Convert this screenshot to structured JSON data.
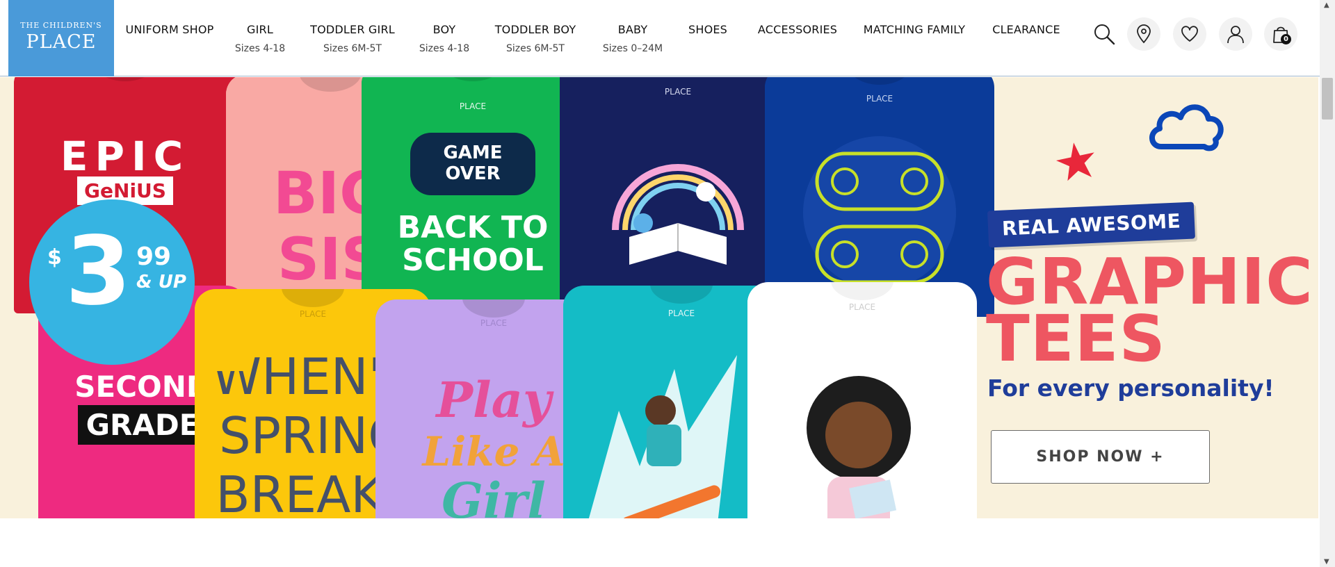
{
  "logo": {
    "line1": "THE CHILDREN'S",
    "line2": "PLACE"
  },
  "nav": [
    {
      "label": "UNIFORM SHOP",
      "sub": ""
    },
    {
      "label": "GIRL",
      "sub": "Sizes 4-18"
    },
    {
      "label": "TODDLER GIRL",
      "sub": "Sizes 6M-5T"
    },
    {
      "label": "BOY",
      "sub": "Sizes 4-18"
    },
    {
      "label": "TODDLER BOY",
      "sub": "Sizes 6M-5T"
    },
    {
      "label": "BABY",
      "sub": "Sizes 0–24M"
    },
    {
      "label": "SHOES",
      "sub": ""
    },
    {
      "label": "ACCESSORIES",
      "sub": ""
    },
    {
      "label": "MATCHING FAMILY",
      "sub": ""
    },
    {
      "label": "CLEARANCE",
      "sub": ""
    }
  ],
  "header_icons": [
    "search-icon",
    "location-pin-icon",
    "heart-icon",
    "account-icon",
    "shopping-bag-icon"
  ],
  "cart": {
    "count": "0"
  },
  "hero": {
    "price": {
      "currency": "$",
      "dollars": "3",
      "cents": "99",
      "suffix": "& UP"
    },
    "tag": "REAL AWESOME",
    "title_line1": "GRAPHIC",
    "title_line2": "TEES",
    "subtitle": "For every personality!",
    "cta": "SHOP NOW  +",
    "tees": {
      "red": {
        "line1": "EPIC",
        "line2": "GeNiUS"
      },
      "pink": {
        "line1": "BIG",
        "line2": "SIS"
      },
      "green": {
        "line1": "GAME",
        "line2": "OVER",
        "line3": "BACK TO",
        "line4": "SCHOOL"
      },
      "magenta": {
        "line1": "SECOND",
        "line2": "GRADE"
      },
      "yellow": {
        "line1": "WHEN'S",
        "line2": "SPRING",
        "line3": "BREAK?"
      },
      "lavender": {
        "line1": "Play",
        "line2": "Like A",
        "line3": "Girl"
      },
      "small_label": "PLACE"
    },
    "colors": {
      "background": "#f9f1dc",
      "badge": "#36b4e2",
      "title": "#ee5661",
      "navy": "#1f3d9a"
    }
  }
}
